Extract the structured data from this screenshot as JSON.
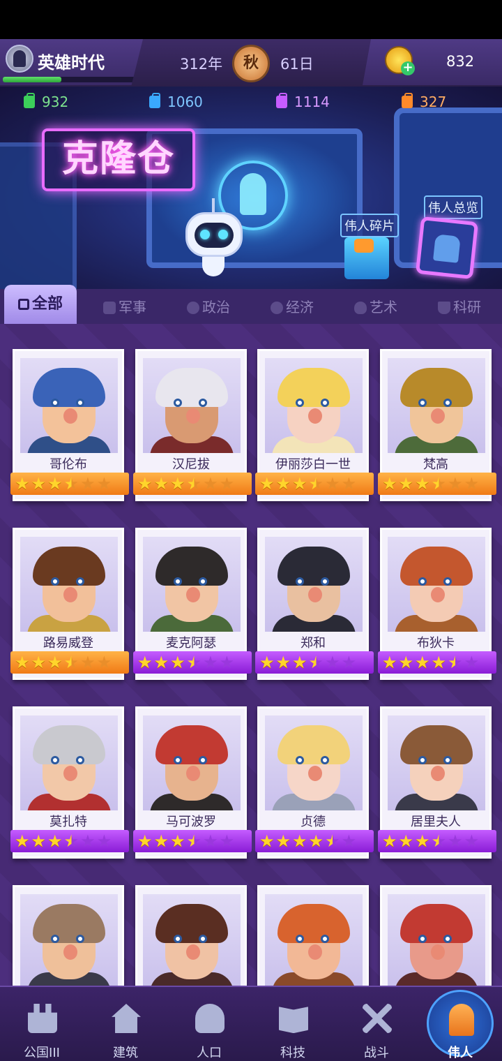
{
  "player": {
    "name": "英雄时代",
    "xp_progress": 0.44
  },
  "calendar": {
    "year": "312年",
    "season": "秋",
    "day": "61日"
  },
  "gold": {
    "amount": "832"
  },
  "resources": [
    {
      "value": "932",
      "color": "#3ccf5a",
      "icon": "green-briefcase-icon"
    },
    {
      "value": "1060",
      "color": "#3aa9ff",
      "icon": "blue-briefcase-icon"
    },
    {
      "value": "1114",
      "color": "#c65cff",
      "icon": "purple-briefcase-icon"
    },
    {
      "value": "327",
      "color": "#ff8a2a",
      "icon": "orange-briefcase-icon"
    }
  ],
  "banner": {
    "title": "克隆仓",
    "fragments_label": "伟人碎片",
    "overview_label": "伟人总览"
  },
  "tabs": [
    {
      "label": "全部",
      "icon": "grid-icon",
      "active": true
    },
    {
      "label": "军事",
      "icon": "shield-icon"
    },
    {
      "label": "政治",
      "icon": "globe-icon"
    },
    {
      "label": "经济",
      "icon": "coins-icon"
    },
    {
      "label": "艺术",
      "icon": "palette-icon"
    },
    {
      "label": "科研",
      "icon": "flask-icon"
    }
  ],
  "heroes": [
    {
      "name": "哥伦布",
      "stars": 3.5,
      "frame": "orange"
    },
    {
      "name": "汉尼拔",
      "stars": 3.5,
      "frame": "orange"
    },
    {
      "name": "伊丽莎白一世",
      "stars": 3.5,
      "frame": "orange"
    },
    {
      "name": "梵高",
      "stars": 3.5,
      "frame": "orange"
    },
    {
      "name": "路易威登",
      "stars": 3.5,
      "frame": "orange"
    },
    {
      "name": "麦克阿瑟",
      "stars": 3.5,
      "frame": "purple"
    },
    {
      "name": "郑和",
      "stars": 3.5,
      "frame": "purple"
    },
    {
      "name": "布狄卡",
      "stars": 4.5,
      "frame": "purple"
    },
    {
      "name": "莫扎特",
      "stars": 3.5,
      "frame": "purple"
    },
    {
      "name": "马可波罗",
      "stars": 3.5,
      "frame": "purple"
    },
    {
      "name": "贞德",
      "stars": 4.5,
      "frame": "purple"
    },
    {
      "name": "居里夫人",
      "stars": 3.5,
      "frame": "purple"
    },
    {
      "name": "",
      "stars": 0,
      "frame": "none"
    },
    {
      "name": "",
      "stars": 0,
      "frame": "none"
    },
    {
      "name": "",
      "stars": 0,
      "frame": "none"
    },
    {
      "name": "",
      "stars": 0,
      "frame": "none"
    }
  ],
  "nav": [
    {
      "label": "公国III",
      "icon": "castle-icon"
    },
    {
      "label": "建筑",
      "icon": "house-icon"
    },
    {
      "label": "人口",
      "icon": "person-icon"
    },
    {
      "label": "科技",
      "icon": "book-icon"
    },
    {
      "label": "战斗",
      "icon": "crossed-swords-icon"
    },
    {
      "label": "伟人",
      "icon": "statue-icon",
      "active": true
    }
  ]
}
